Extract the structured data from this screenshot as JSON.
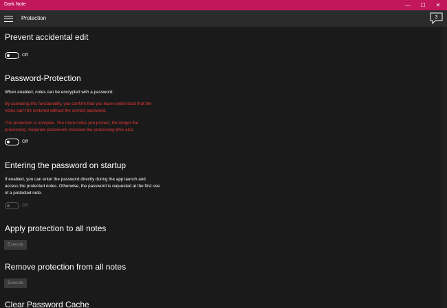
{
  "window": {
    "title": "Dark Note",
    "min_glyph": "—",
    "max_glyph": "☐",
    "close_glyph": "✕"
  },
  "header": {
    "page_title": "Protection",
    "notification_count": "3"
  },
  "sections": {
    "prevent_edit": {
      "title": "Prevent accidental edit",
      "toggle_state": "Off"
    },
    "password_protection": {
      "title": "Password-Protection",
      "description": "When enabled, notes can be encrypted with a password.",
      "warning_1": "By activating this functionality, you confirm that you have understood that the notes can't be restored without the correct password.",
      "warning_2": "The protection is complex. The more notes you protect, the longer the processing. Separate passwords increase the processing time also.",
      "toggle_state": "Off"
    },
    "password_startup": {
      "title": "Entering the password on startup",
      "description": "If enabled, you can enter the password directly during the app launch and access the protected notes. Otherwise, the password is requested at the first use of a protected note.",
      "toggle_state": "Off"
    },
    "apply_all": {
      "title": "Apply protection to all notes",
      "button": "Execute"
    },
    "remove_all": {
      "title": "Remove protection from all notes",
      "button": "Execute"
    },
    "clear_cache": {
      "title": "Clear Password Cache"
    }
  },
  "colors": {
    "titlebar": "#c2185b",
    "background": "#1a1a1a",
    "warning": "#e53935"
  }
}
